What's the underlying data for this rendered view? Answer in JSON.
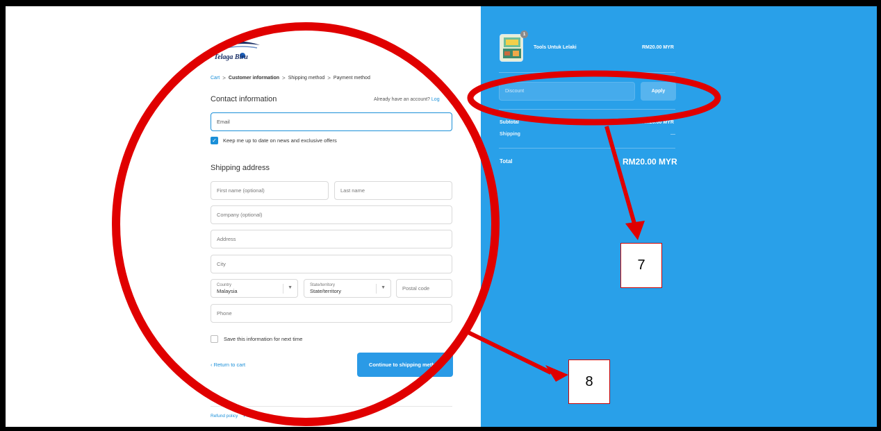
{
  "store": {
    "logo_text": "Telaga Biru"
  },
  "breadcrumb": {
    "cart": "Cart",
    "customer_information": "Customer information",
    "shipping_method": "Shipping method",
    "payment_method": "Payment method",
    "separator": ">"
  },
  "contact": {
    "title": "Contact information",
    "account_prompt": "Already have an account?",
    "login_link": "Log",
    "email_placeholder": "Email",
    "newsletter_label": "Keep me up to date on news and exclusive offers",
    "newsletter_checked": true
  },
  "shipping": {
    "title": "Shipping address",
    "first_name_placeholder": "First name (optional)",
    "last_name_placeholder": "Last name",
    "company_placeholder": "Company (optional)",
    "address_placeholder": "Address",
    "city_placeholder": "City",
    "country_label": "Country",
    "country_value": "Malaysia",
    "state_label": "State/territory",
    "state_value": "State/territory",
    "postal_placeholder": "Postal code",
    "phone_placeholder": "Phone",
    "save_info_label": "Save this information for next time",
    "save_info_checked": false
  },
  "actions": {
    "return_label": "Return to cart",
    "continue_label": "Continue to shipping method"
  },
  "footer": {
    "refund_policy": "Refund policy",
    "privacy_policy": "Privacy policy"
  },
  "summary": {
    "product_name": "Tools Untuk Lelaki",
    "product_price": "RM20.00 MYR",
    "quantity": "1",
    "discount_placeholder": "Discount",
    "apply_label": "Apply",
    "subtotal_label": "Subtotal",
    "subtotal_value": "RM20.00 MYR",
    "shipping_label": "Shipping",
    "shipping_value": "—",
    "total_label": "Total",
    "total_value": "RM20.00 MYR"
  },
  "annotations": {
    "callout_7": "7",
    "callout_8": "8",
    "annotation_color": "#e00000"
  },
  "colors": {
    "accent": "#1a8fd8",
    "summary_bg": "#29a0e9",
    "frame": "#000000"
  },
  "icons": {
    "breadcrumb_separator": "chevron-right-icon",
    "select_caret": "caret-down-icon",
    "return": "chevron-left-icon",
    "checkbox": "check-icon"
  }
}
